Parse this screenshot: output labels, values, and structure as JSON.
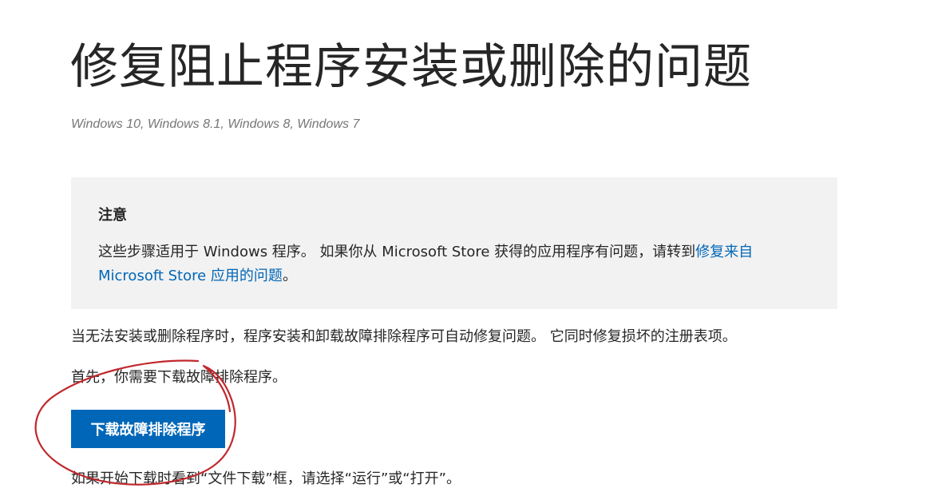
{
  "article": {
    "title": "修复阻止程序安装或删除的问题",
    "applies_to": "Windows 10, Windows 8.1, Windows 8, Windows 7"
  },
  "note": {
    "heading": "注意",
    "text_before_link": "这些步骤适用于 Windows 程序。 如果你从 Microsoft Store 获得的应用程序有问题，请转到",
    "link_text": "修复来自 Microsoft Store 应用的问题",
    "text_after_link": "。"
  },
  "body": {
    "paragraph1": "当无法安装或删除程序时，程序安装和卸载故障排除程序可自动修复问题。 它同时修复损坏的注册表项。",
    "paragraph2": "首先，你需要下载故障排除程序。",
    "download_button": "下载故障排除程序",
    "paragraph3": "如果开始下载时看到“文件下载”框，请选择“运行”或“打开”。"
  },
  "colors": {
    "accent": "#0067b8",
    "note_background": "#f2f2f2",
    "annotation_circle": "#c0282d"
  }
}
